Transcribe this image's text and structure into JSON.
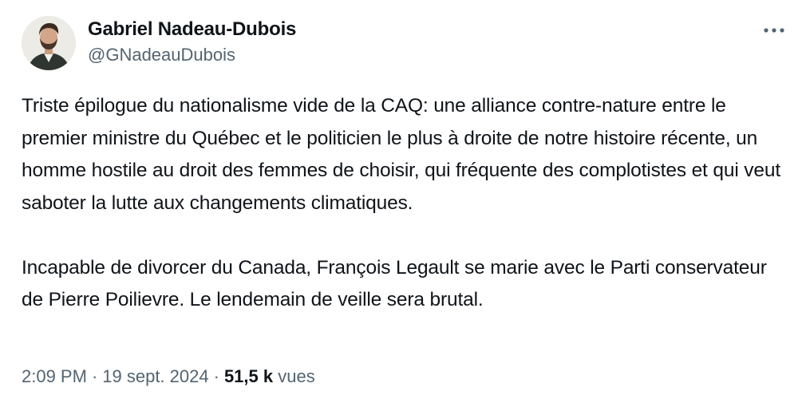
{
  "author": {
    "name": "Gabriel Nadeau-Dubois",
    "handle": "@GNadeauDubois"
  },
  "icons": {
    "more": "more-horizontal-icon"
  },
  "tweet": {
    "paragraphs": [
      "Triste épilogue du nationalisme vide de la CAQ: une alliance contre-nature entre le premier ministre du Québec et le politicien le plus à droite de notre histoire récente, un homme hostile au droit des femmes de choisir, qui fréquente des complotistes et qui veut saboter la lutte aux changements climatiques.",
      "Incapable de divorcer du Canada, François Legault se marie avec le Parti conservateur de Pierre Poilievre. Le lendemain de veille sera brutal."
    ]
  },
  "meta": {
    "time": "2:09 PM",
    "separator": "·",
    "date": "19 sept. 2024",
    "views_count": "51,5 k",
    "views_label": "vues"
  },
  "colors": {
    "text": "#0f1419",
    "secondary": "#536471",
    "background": "#ffffff"
  }
}
